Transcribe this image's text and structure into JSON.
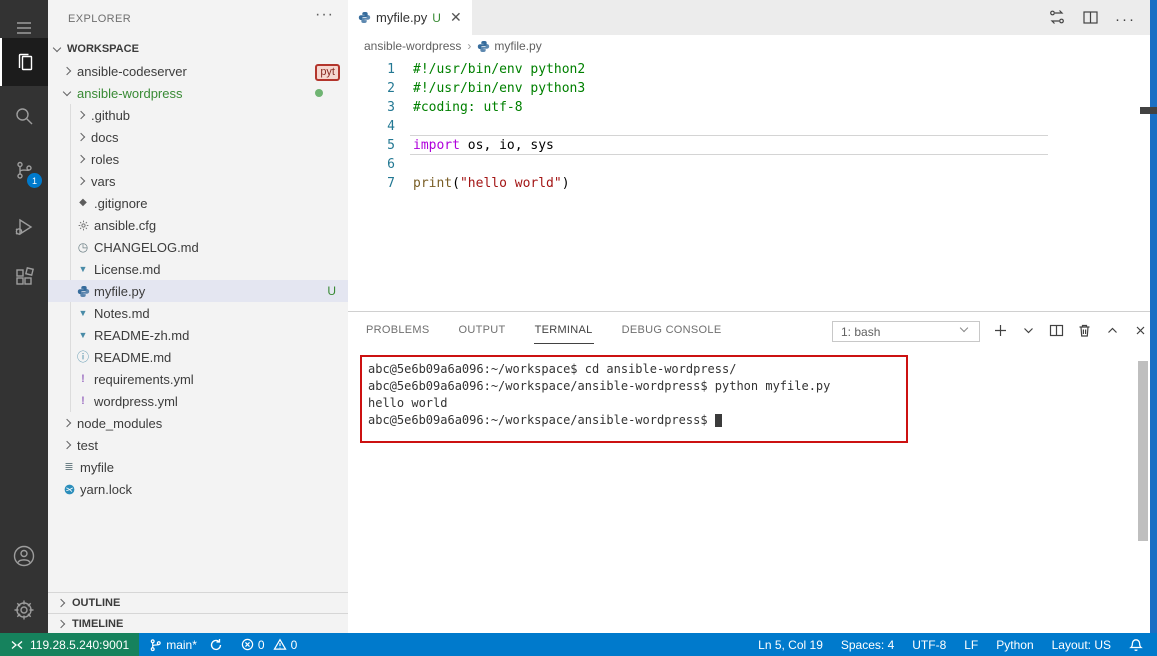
{
  "explorer": {
    "title": "EXPLORER",
    "section_header": "WORKSPACE",
    "filter_badge": "pyt",
    "tree": [
      {
        "label": "ansible-codeserver",
        "kind": "folder",
        "chevron": "right",
        "level": 0
      },
      {
        "label": "ansible-wordpress",
        "kind": "folder",
        "chevron": "down",
        "level": 0,
        "color": "green"
      },
      {
        "label": ".github",
        "kind": "folder",
        "chevron": "right",
        "level": 1
      },
      {
        "label": "docs",
        "kind": "folder",
        "chevron": "right",
        "level": 1
      },
      {
        "label": "roles",
        "kind": "folder",
        "chevron": "right",
        "level": 1
      },
      {
        "label": "vars",
        "kind": "folder",
        "chevron": "right",
        "level": 1
      },
      {
        "label": ".gitignore",
        "kind": "file",
        "icon": "git",
        "level": 1
      },
      {
        "label": "ansible.cfg",
        "kind": "file",
        "icon": "gear",
        "level": 1
      },
      {
        "label": "CHANGELOG.md",
        "kind": "file",
        "icon": "clock",
        "level": 1
      },
      {
        "label": "License.md",
        "kind": "file",
        "icon": "markdown",
        "level": 1
      },
      {
        "label": "myfile.py",
        "kind": "file",
        "icon": "python",
        "level": 1,
        "selected": true,
        "badge": "U"
      },
      {
        "label": "Notes.md",
        "kind": "file",
        "icon": "markdown",
        "level": 1
      },
      {
        "label": "README-zh.md",
        "kind": "file",
        "icon": "markdown",
        "level": 1
      },
      {
        "label": "README.md",
        "kind": "file",
        "icon": "info",
        "level": 1
      },
      {
        "label": "requirements.yml",
        "kind": "file",
        "icon": "yaml",
        "level": 1
      },
      {
        "label": "wordpress.yml",
        "kind": "file",
        "icon": "yaml",
        "level": 1
      },
      {
        "label": "node_modules",
        "kind": "folder",
        "chevron": "right",
        "level": 0
      },
      {
        "label": "test",
        "kind": "folder",
        "chevron": "right",
        "level": 0
      },
      {
        "label": "myfile",
        "kind": "file",
        "icon": "list",
        "level": 0
      },
      {
        "label": "yarn.lock",
        "kind": "file",
        "icon": "yarn",
        "level": 0
      }
    ],
    "bottom_sections": [
      {
        "label": "OUTLINE"
      },
      {
        "label": "TIMELINE"
      }
    ]
  },
  "editor": {
    "tab": {
      "label": "myfile.py",
      "dirty": "U"
    },
    "breadcrumbs": [
      {
        "label": "ansible-wordpress"
      },
      {
        "label": "myfile.py",
        "icon": "python"
      }
    ],
    "code_lines": [
      {
        "n": "1",
        "seg": [
          {
            "t": "#!/usr/bin/env python2",
            "c": "comment"
          }
        ]
      },
      {
        "n": "2",
        "seg": [
          {
            "t": "#!/usr/bin/env python3",
            "c": "comment"
          }
        ]
      },
      {
        "n": "3",
        "seg": [
          {
            "t": "#coding: utf-8",
            "c": "comment"
          }
        ]
      },
      {
        "n": "4",
        "seg": []
      },
      {
        "n": "5",
        "seg": [
          {
            "t": "import",
            "c": "keyword"
          },
          {
            "t": " os, io, sys",
            "c": "plain"
          }
        ],
        "current": true
      },
      {
        "n": "6",
        "seg": []
      },
      {
        "n": "7",
        "seg": [
          {
            "t": "print",
            "c": "function"
          },
          {
            "t": "(",
            "c": "plain"
          },
          {
            "t": "\"hello world\"",
            "c": "string"
          },
          {
            "t": ")",
            "c": "plain"
          }
        ]
      }
    ]
  },
  "panel": {
    "tabs": [
      {
        "label": "PROBLEMS"
      },
      {
        "label": "OUTPUT"
      },
      {
        "label": "TERMINAL",
        "active": true
      },
      {
        "label": "DEBUG CONSOLE"
      }
    ],
    "terminal_select": "1: bash",
    "terminal_lines": [
      "abc@5e6b09a6a096:~/workspace$ cd ansible-wordpress/",
      "abc@5e6b09a6a096:~/workspace/ansible-wordpress$ python myfile.py",
      "hello world",
      "abc@5e6b09a6a096:~/workspace/ansible-wordpress$ "
    ]
  },
  "status_bar": {
    "remote": "119.28.5.240:9001",
    "branch": "main*",
    "errors": "0",
    "warnings": "0",
    "right_items": [
      "Ln 5, Col 19",
      "Spaces: 4",
      "UTF-8",
      "LF",
      "Python",
      "Layout: US"
    ]
  },
  "scm_badge": "1",
  "colors": {
    "accent_blue": "#007acc",
    "remote_green": "#16825d",
    "comment": "#008000",
    "keyword": "#af00db",
    "string": "#a31515",
    "function": "#795e26",
    "annotation_red": "#cc1111",
    "untracked_green": "#388a34"
  }
}
